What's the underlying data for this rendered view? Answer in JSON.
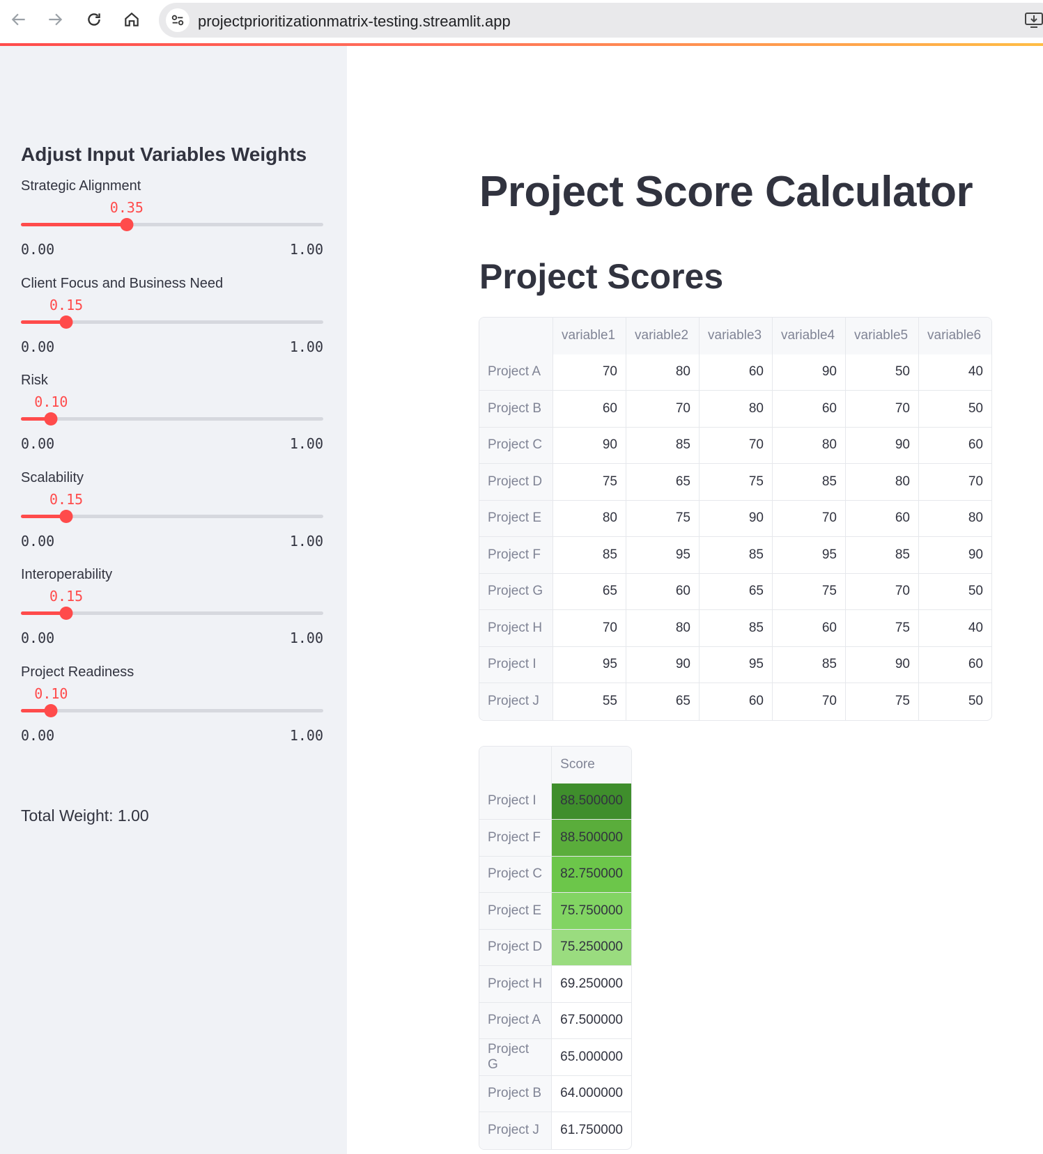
{
  "browser": {
    "url": "projectprioritizationmatrix-testing.streamlit.app"
  },
  "sidebar": {
    "heading": "Adjust Input Variables Weights",
    "sliders": [
      {
        "label": "Strategic Alignment",
        "value": "0.35",
        "fraction": 0.35,
        "min": "0.00",
        "max": "1.00"
      },
      {
        "label": "Client Focus and Business Need",
        "value": "0.15",
        "fraction": 0.15,
        "min": "0.00",
        "max": "1.00"
      },
      {
        "label": "Risk",
        "value": "0.10",
        "fraction": 0.1,
        "min": "0.00",
        "max": "1.00"
      },
      {
        "label": "Scalability",
        "value": "0.15",
        "fraction": 0.15,
        "min": "0.00",
        "max": "1.00"
      },
      {
        "label": "Interoperability",
        "value": "0.15",
        "fraction": 0.15,
        "min": "0.00",
        "max": "1.00"
      },
      {
        "label": "Project Readiness",
        "value": "0.10",
        "fraction": 0.1,
        "min": "0.00",
        "max": "1.00"
      }
    ],
    "total": "Total Weight: 1.00"
  },
  "main": {
    "title": "Project Score Calculator",
    "subtitle": "Project Scores",
    "variables_table": {
      "columns": [
        "",
        "variable1",
        "variable2",
        "variable3",
        "variable4",
        "variable5",
        "variable6"
      ],
      "rows": [
        {
          "name": "Project A",
          "values": [
            "70",
            "80",
            "60",
            "90",
            "50",
            "40"
          ]
        },
        {
          "name": "Project B",
          "values": [
            "60",
            "70",
            "80",
            "60",
            "70",
            "50"
          ]
        },
        {
          "name": "Project C",
          "values": [
            "90",
            "85",
            "70",
            "80",
            "90",
            "60"
          ]
        },
        {
          "name": "Project D",
          "values": [
            "75",
            "65",
            "75",
            "85",
            "80",
            "70"
          ]
        },
        {
          "name": "Project E",
          "values": [
            "80",
            "75",
            "90",
            "70",
            "60",
            "80"
          ]
        },
        {
          "name": "Project F",
          "values": [
            "85",
            "95",
            "85",
            "95",
            "85",
            "90"
          ]
        },
        {
          "name": "Project G",
          "values": [
            "65",
            "60",
            "65",
            "75",
            "70",
            "50"
          ]
        },
        {
          "name": "Project H",
          "values": [
            "70",
            "80",
            "85",
            "60",
            "75",
            "40"
          ]
        },
        {
          "name": "Project I",
          "values": [
            "95",
            "90",
            "95",
            "85",
            "90",
            "60"
          ]
        },
        {
          "name": "Project J",
          "values": [
            "55",
            "65",
            "60",
            "70",
            "75",
            "50"
          ]
        }
      ]
    },
    "score_table": {
      "columns": [
        "",
        "Score"
      ],
      "rows": [
        {
          "name": "Project I",
          "score": "88.500000",
          "bg": "#3f8e2c"
        },
        {
          "name": "Project F",
          "score": "88.500000",
          "bg": "#5aad3b"
        },
        {
          "name": "Project C",
          "score": "82.750000",
          "bg": "#6cc64a"
        },
        {
          "name": "Project E",
          "score": "75.750000",
          "bg": "#82d463"
        },
        {
          "name": "Project D",
          "score": "75.250000",
          "bg": "#9adc7f"
        },
        {
          "name": "Project H",
          "score": "69.250000",
          "bg": ""
        },
        {
          "name": "Project A",
          "score": "67.500000",
          "bg": ""
        },
        {
          "name": "Project G",
          "score": "65.000000",
          "bg": ""
        },
        {
          "name": "Project B",
          "score": "64.000000",
          "bg": ""
        },
        {
          "name": "Project J",
          "score": "61.750000",
          "bg": ""
        }
      ]
    }
  }
}
